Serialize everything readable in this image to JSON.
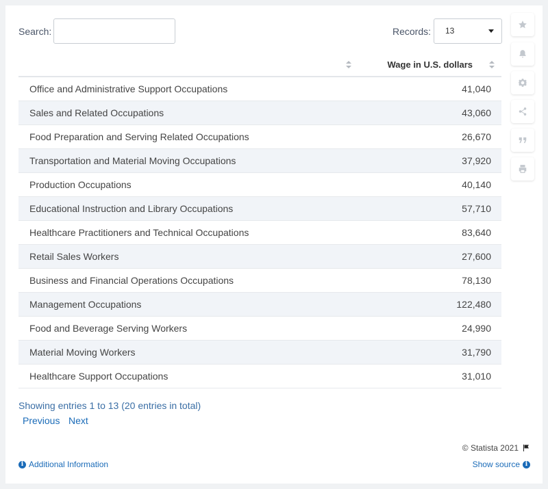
{
  "search": {
    "label": "Search:",
    "value": "",
    "placeholder": ""
  },
  "records": {
    "label": "Records:",
    "value": "13"
  },
  "side_toolbar": [
    "star-icon",
    "bell-icon",
    "gear-icon",
    "share-icon",
    "quote-icon",
    "print-icon"
  ],
  "table": {
    "columns": [
      "",
      "Wage in U.S. dollars"
    ],
    "rows": [
      {
        "occupation": "Office and Administrative Support Occupations",
        "wage": "41,040"
      },
      {
        "occupation": "Sales and Related Occupations",
        "wage": "43,060"
      },
      {
        "occupation": "Food Preparation and Serving Related Occupations",
        "wage": "26,670"
      },
      {
        "occupation": "Transportation and Material Moving Occupations",
        "wage": "37,920"
      },
      {
        "occupation": "Production Occupations",
        "wage": "40,140"
      },
      {
        "occupation": "Educational Instruction and Library Occupations",
        "wage": "57,710"
      },
      {
        "occupation": "Healthcare Practitioners and Technical Occupations",
        "wage": "83,640"
      },
      {
        "occupation": "Retail Sales Workers",
        "wage": "27,600"
      },
      {
        "occupation": "Business and Financial Operations Occupations",
        "wage": "78,130"
      },
      {
        "occupation": "Management Occupations",
        "wage": "122,480"
      },
      {
        "occupation": "Food and Beverage Serving Workers",
        "wage": "24,990"
      },
      {
        "occupation": "Material Moving Workers",
        "wage": "31,790"
      },
      {
        "occupation": "Healthcare Support Occupations",
        "wage": "31,010"
      }
    ]
  },
  "chart_data": {
    "type": "table",
    "columns": [
      "",
      "Wage in U.S. dollars"
    ],
    "categories": [
      "Office and Administrative Support Occupations",
      "Sales and Related Occupations",
      "Food Preparation and Serving Related Occupations",
      "Transportation and Material Moving Occupations",
      "Production Occupations",
      "Educational Instruction and Library Occupations",
      "Healthcare Practitioners and Technical Occupations",
      "Retail Sales Workers",
      "Business and Financial Operations Occupations",
      "Management Occupations",
      "Food and Beverage Serving Workers",
      "Material Moving Workers",
      "Healthcare Support Occupations"
    ],
    "values": [
      41040,
      43060,
      26670,
      37920,
      40140,
      57710,
      83640,
      27600,
      78130,
      122480,
      24990,
      31790,
      31010
    ]
  },
  "pagination": {
    "info": "Showing entries 1 to 13 (20 entries in total)",
    "previous": "Previous",
    "next": "Next"
  },
  "footer": {
    "copyright": "© Statista 2021",
    "additional_info": "Additional Information",
    "show_source": "Show source"
  },
  "colors": {
    "link": "#1a6bb8",
    "row_stripe": "#f1f4f8",
    "background": "#f0f2f4"
  }
}
